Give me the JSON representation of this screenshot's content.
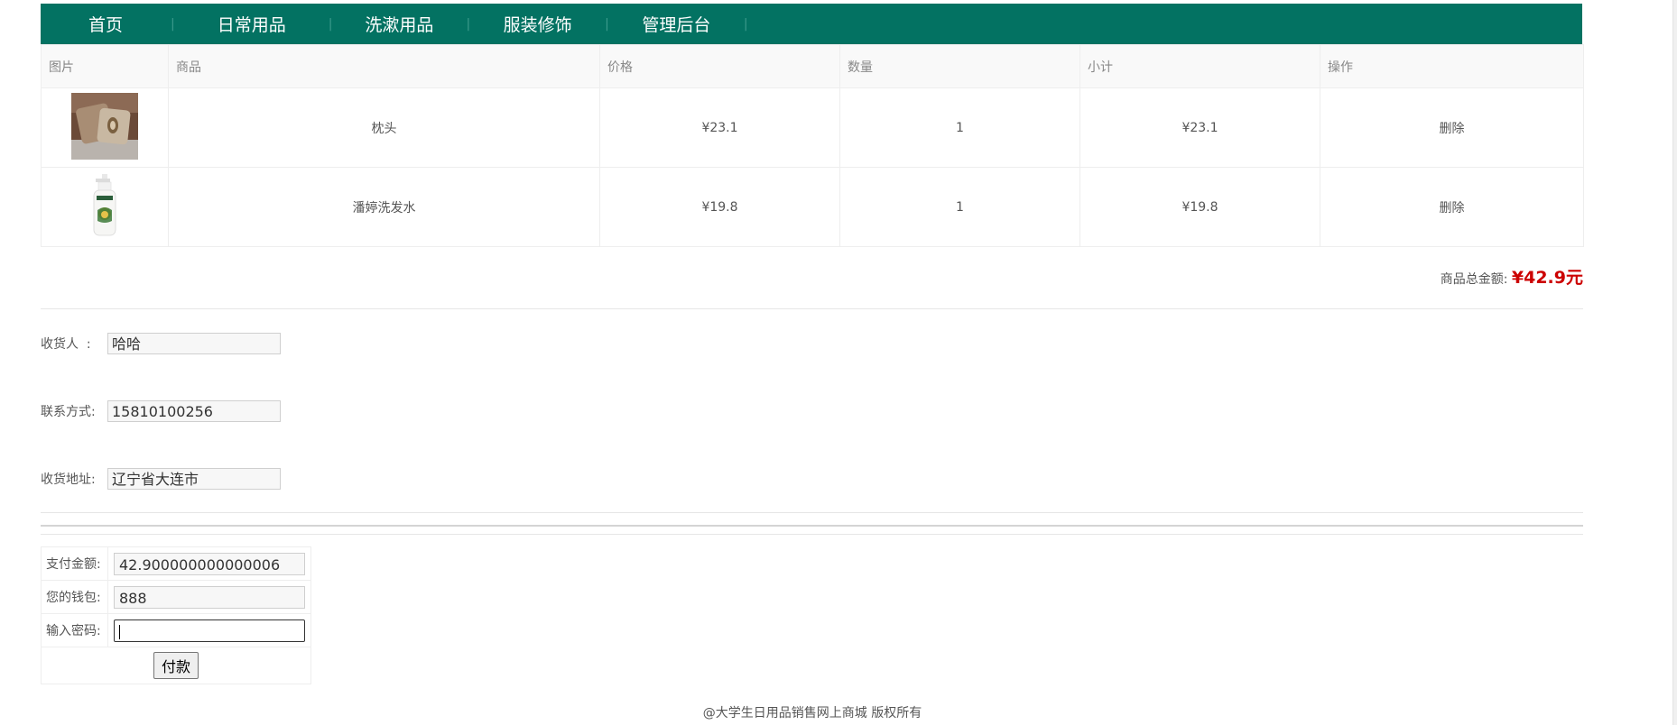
{
  "nav": {
    "items": [
      {
        "label": "首页"
      },
      {
        "label": "日常用品"
      },
      {
        "label": "洗漱用品"
      },
      {
        "label": "服装修饰"
      },
      {
        "label": "管理后台"
      }
    ],
    "separator": "|",
    "bg_color": "#037262"
  },
  "cart": {
    "headers": [
      "图片",
      "商品",
      "价格",
      "数量",
      "小计",
      "操作"
    ],
    "rows": [
      {
        "image_icon": "pillow-image",
        "name": "枕头",
        "price": "¥23.1",
        "qty": "1",
        "subtotal": "¥23.1",
        "action": "删除"
      },
      {
        "image_icon": "shampoo-bottle-image",
        "name": "潘婷洗发水",
        "price": "¥19.8",
        "qty": "1",
        "subtotal": "¥19.8",
        "action": "删除"
      }
    ]
  },
  "total": {
    "label": "商品总金额:",
    "amount": "¥42.9元",
    "amount_color": "#cc0000"
  },
  "form": {
    "recipient": {
      "label": "收货人  :",
      "value": "哈哈"
    },
    "contact": {
      "label": "联系方式:",
      "value": "15810100256"
    },
    "address": {
      "label": "收货地址:",
      "value": "辽宁省大连市"
    }
  },
  "payment": {
    "amount": {
      "label": "支付金额:",
      "value": "42.900000000000006"
    },
    "wallet": {
      "label": "您的钱包:",
      "value": "888"
    },
    "password": {
      "label": "输入密码:",
      "value": ""
    },
    "submit_label": "付款"
  },
  "footer": {
    "text": "@大学生日用品销售网上商城 版权所有"
  }
}
